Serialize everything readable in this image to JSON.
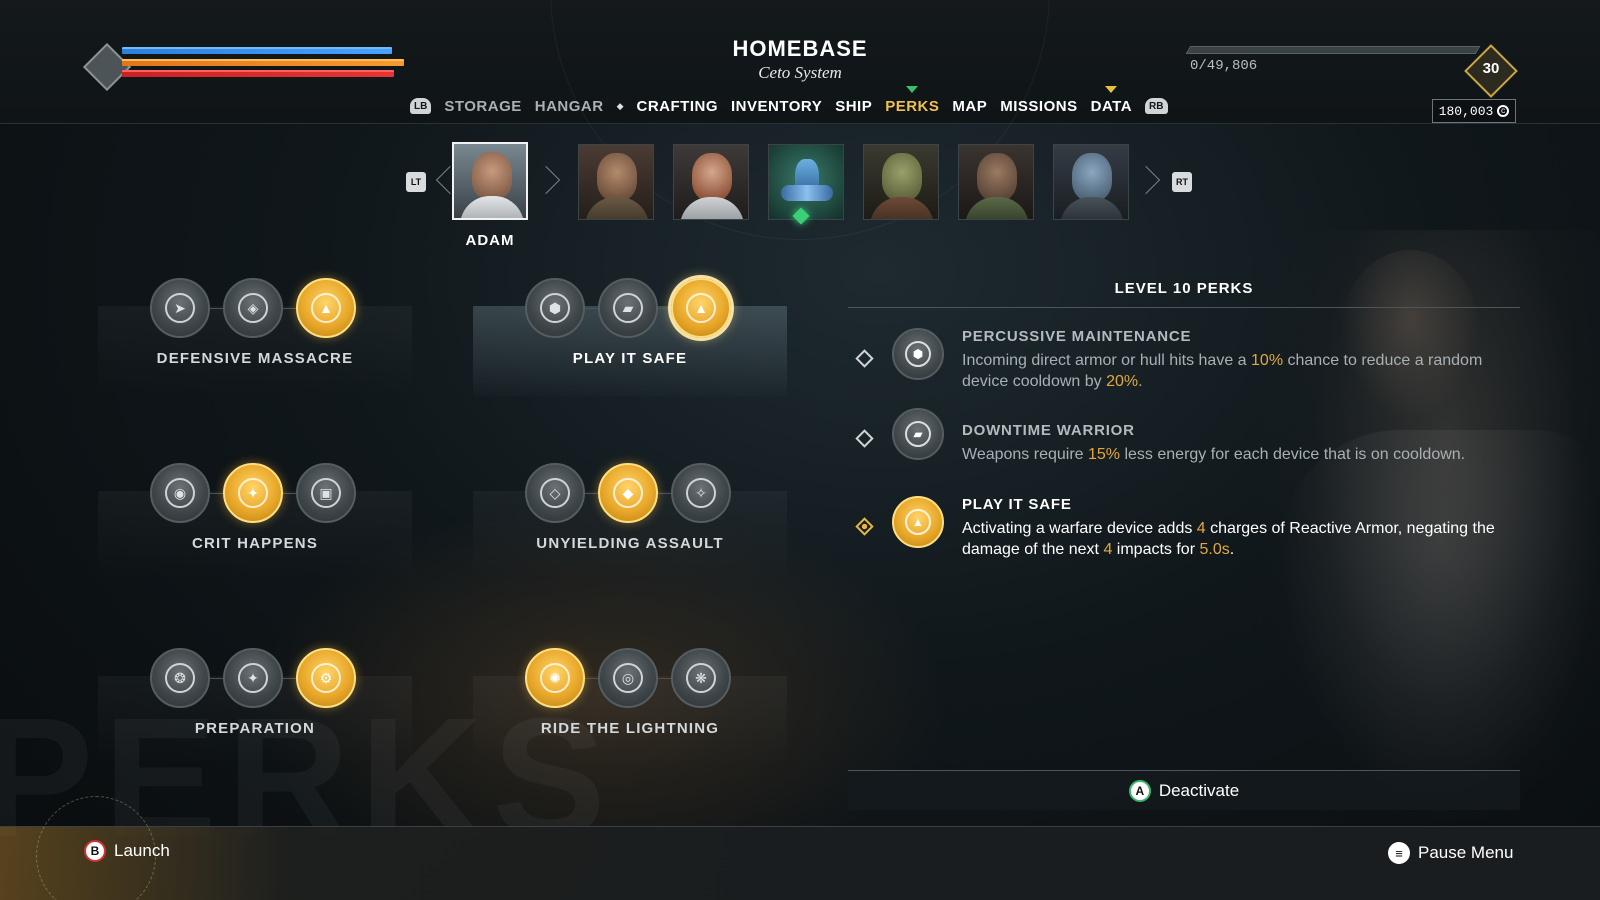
{
  "location": {
    "title": "HOMEBASE",
    "subtitle": "Ceto System"
  },
  "xp": {
    "text": "0/49,806"
  },
  "level": "30",
  "credits": "180,003",
  "nav": {
    "left_bumper": "LB",
    "right_bumper": "RB",
    "items": [
      "STORAGE",
      "HANGAR",
      "CRAFTING",
      "INVENTORY",
      "SHIP",
      "PERKS",
      "MAP",
      "MISSIONS",
      "DATA"
    ],
    "active": "PERKS"
  },
  "crew": {
    "left_trigger": "LT",
    "right_trigger": "RT",
    "selected_name": "ADAM",
    "members": [
      "adam",
      "crew-2",
      "crew-3",
      "ship",
      "crew-5",
      "crew-6",
      "crew-7"
    ]
  },
  "perk_groups": [
    {
      "name": "DEFENSIVE MASSACRE",
      "icons": [
        "wing-icon",
        "shield-crest-icon",
        "reactive-armor-icon"
      ],
      "active_index": 2
    },
    {
      "name": "PLAY IT SAFE",
      "icons": [
        "hex-armor-icon",
        "downtime-icon",
        "reactive-armor-icon"
      ],
      "active_index": 2
    },
    {
      "name": "CRIT HAPPENS",
      "icons": [
        "target-icon",
        "starburst-icon",
        "clipboard-icon"
      ],
      "active_index": 1
    },
    {
      "name": "UNYIELDING ASSAULT",
      "icons": [
        "diamond-icon",
        "diamond-burst-icon",
        "diamond-star-icon"
      ],
      "active_index": 1
    },
    {
      "name": "PREPARATION",
      "icons": [
        "wheel-icon",
        "sparkle-icon",
        "gear-icon"
      ],
      "active_index": 2
    },
    {
      "name": "RIDE THE LIGHTNING",
      "icons": [
        "lightning-icon",
        "cooldown-icon",
        "flower-icon"
      ],
      "active_index": 0
    }
  ],
  "details": {
    "heading": "LEVEL 10 PERKS",
    "perks": [
      {
        "name": "PERCUSSIVE MAINTENANCE",
        "desc": [
          {
            "t": "Incoming direct armor or hull hits have a "
          },
          {
            "t": "10%",
            "h": true
          },
          {
            "t": " chance to reduce a random device cooldown by "
          },
          {
            "t": "20%",
            "h": true
          },
          {
            "t": "."
          }
        ]
      },
      {
        "name": "DOWNTIME WARRIOR",
        "desc": [
          {
            "t": "Weapons require "
          },
          {
            "t": "15%",
            "h": true
          },
          {
            "t": " less energy for each device that is on cooldown."
          }
        ]
      },
      {
        "name": "PLAY IT SAFE",
        "desc": [
          {
            "t": "Activating a warfare device adds "
          },
          {
            "t": "4",
            "h": true
          },
          {
            "t": " charges of Reactive Armor, negating the damage of the next "
          },
          {
            "t": "4",
            "h": true
          },
          {
            "t": " impacts for "
          },
          {
            "t": "5.0s",
            "h": true
          },
          {
            "t": "."
          }
        ]
      }
    ]
  },
  "actions": {
    "a_button": "A",
    "deactivate": "Deactivate",
    "b_button": "B",
    "launch": "Launch",
    "pause_menu": "Pause Menu"
  },
  "colors": {
    "accent_gold": "#e2a83a",
    "nav_active": "#f0c050",
    "shield_bar": "#4aa2ff",
    "armor_bar": "#f59a30",
    "hull_bar": "#e53535",
    "active_marker": "#3bbf68"
  }
}
